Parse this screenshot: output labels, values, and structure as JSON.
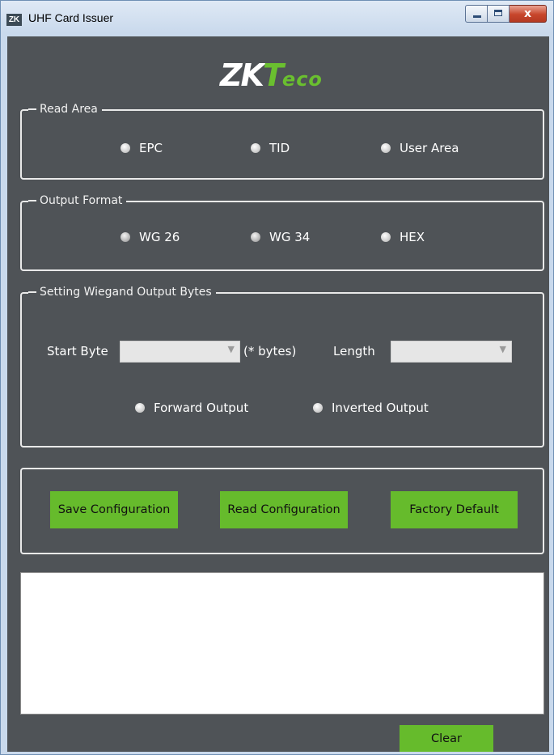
{
  "window": {
    "icon_text": "ZK",
    "title": "UHF Card Issuer",
    "close_glyph": "x"
  },
  "logo": {
    "part1": "ZK",
    "part2": "T",
    "part3": "eco"
  },
  "read_area": {
    "legend": "Read Area",
    "options": [
      "EPC",
      "TID",
      "User Area"
    ]
  },
  "output_format": {
    "legend": "Output Format",
    "options": [
      "WG 26",
      "WG 34",
      "HEX"
    ]
  },
  "wiegand": {
    "legend": "Setting Wiegand Output Bytes",
    "start_byte_label": "Start Byte",
    "start_byte_value": "",
    "bytes_hint": "(* bytes)",
    "length_label": "Length",
    "length_value": "",
    "forward_label": "Forward Output",
    "inverted_label": "Inverted Output"
  },
  "actions": {
    "save": "Save Configuration",
    "read": "Read Configuration",
    "factory": "Factory Default"
  },
  "log": {
    "text": ""
  },
  "clear": "Clear",
  "colors": {
    "accent": "#66bb2c",
    "panel": "#4f5357"
  }
}
